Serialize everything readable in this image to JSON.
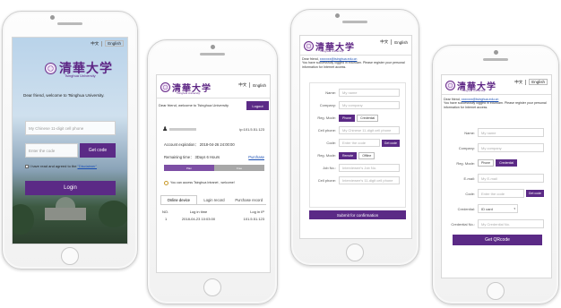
{
  "common": {
    "lang_cn": "中文",
    "lang_en": "English",
    "univ_cn": "清華大学",
    "univ_en": "Tsinghua University"
  },
  "screen1": {
    "welcome": "Dear friend, welcome to Tsinghua University.",
    "phone_placeholder": "My Chinese 11-digit cell phone",
    "code_placeholder": "Enter the code",
    "get_code": "Get code",
    "agree_text": "I have read and agreed to the ",
    "disclaimer_link": "\"Disclaimer\"",
    "login": "Login"
  },
  "screen2": {
    "welcome": "Dear friend, welcome to Tsinghua University",
    "logout": "Logout",
    "user_ip": "ip:101.5.51.123",
    "expiration": "Account expiration： 2018-04-26 24:00:00",
    "remaining": "Remaining time： 3Days 6 Hours",
    "purchase": "Purchase",
    "plan_a": "Plan",
    "plan_b": "Free",
    "notice": "You can access Tsinghua Intranet , welcome!",
    "tabs": [
      "Online device",
      "Login record",
      "Purchase record"
    ],
    "table_headers": [
      "NO.",
      "Log in time",
      "Log in IP"
    ],
    "rows": [
      [
        "1",
        "2018-04-23 10:03:00",
        "101.5.51.123"
      ]
    ]
  },
  "screen3": {
    "greeting_prefix": "Dear friend, ",
    "greeting_email": "xxxxxxx@tsinghua.edu.cn",
    "message": "You have successfully logged in eduroam. Please register your personal information for Internet access.",
    "fields": [
      {
        "label": "Name:",
        "placeholder": "My name"
      },
      {
        "label": "Company:",
        "placeholder": "My company"
      },
      {
        "label": "Reg. Mode:",
        "options": [
          "Phone",
          "Credential"
        ],
        "selected": 0
      },
      {
        "label": "Cell phone:",
        "placeholder": "My Chinese 11-digit cell phone"
      },
      {
        "label": "Code:",
        "placeholder": "Enter the code",
        "button": "Get code"
      },
      {
        "label": "Reg. Mode:",
        "options": [
          "Remote",
          "Offline"
        ],
        "selected": 0
      },
      {
        "label": "Job No.:",
        "placeholder": "Interviewee's Job No."
      },
      {
        "label": "Cell phone:",
        "placeholder": "Interviewee's 11-digit cell phone"
      }
    ],
    "submit": "Submit for confirmation"
  },
  "screen4": {
    "greeting_prefix": "Dear friend, ",
    "greeting_email": "xxxxxxx@tsinghua.edu.cn",
    "message": "You have successfully logged in eduroam. Please register your personal information for Internet access.",
    "fields": [
      {
        "label": "Name:",
        "placeholder": "My name"
      },
      {
        "label": "Company:",
        "placeholder": "My company"
      },
      {
        "label": "Reg. Mode:",
        "options": [
          "Phone",
          "Credential"
        ],
        "selected": 1
      },
      {
        "label": "E-mail:",
        "placeholder": "My E-mail"
      },
      {
        "label": "Code:",
        "placeholder": "Enter the code",
        "button": "Get code"
      },
      {
        "label": "Credential:",
        "placeholder": "ID card"
      },
      {
        "label": "Credential No.:",
        "placeholder": "My Credential No."
      }
    ],
    "submit": "Get QRcode"
  }
}
